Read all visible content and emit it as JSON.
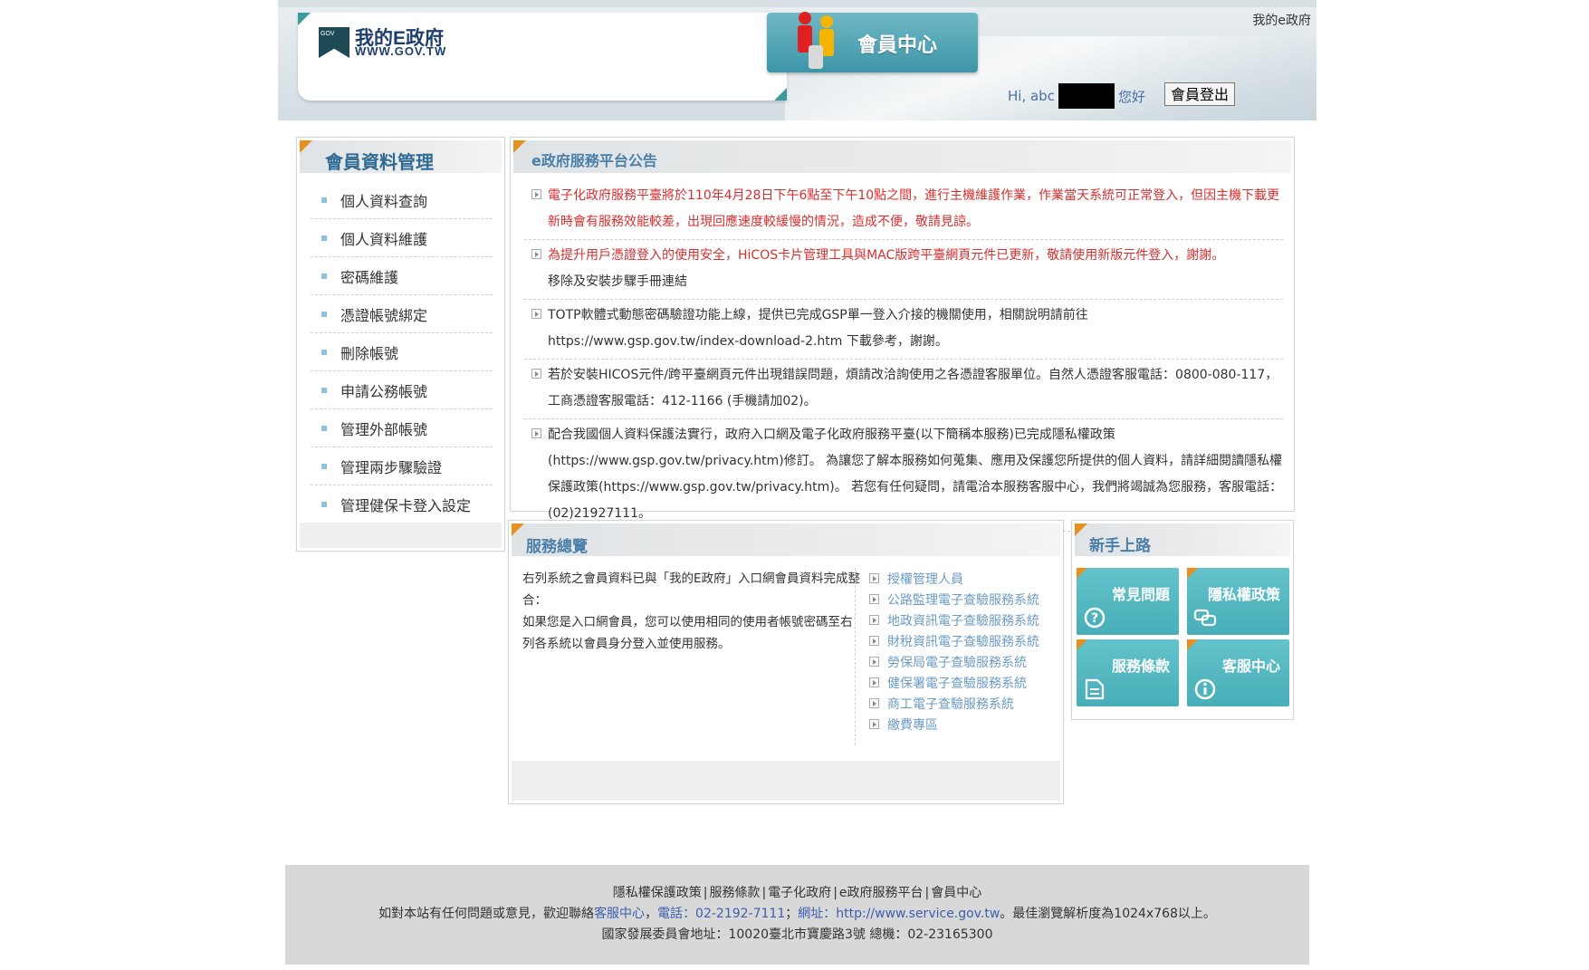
{
  "header": {
    "logo_main": "我的E政府",
    "logo_url": "WWW.GOV.TW",
    "logo_badge": "GOV",
    "banner_title": "會員中心",
    "top_link": "我的e政府",
    "greeting_prefix": "Hi, abc",
    "greeting_suffix": "您好",
    "logout_label": "會員登出"
  },
  "sidebar": {
    "title": "會員資料管理",
    "items": [
      {
        "label": "個人資料查詢"
      },
      {
        "label": "個人資料維護"
      },
      {
        "label": "密碼維護"
      },
      {
        "label": "憑證帳號綁定"
      },
      {
        "label": "刪除帳號"
      },
      {
        "label": "申請公務帳號"
      },
      {
        "label": "管理外部帳號"
      },
      {
        "label": "管理兩步驟驗證"
      },
      {
        "label": "管理健保卡登入設定"
      }
    ]
  },
  "announcements": {
    "title": "e政府服務平台公告",
    "items": [
      {
        "text": "電子化政府服務平臺將於110年4月28日下午6點至下午10點之間，進行主機維護作業，作業當天系統可正常登入，但因主機下載更新時會有服務效能較差，出現回應速度較緩慢的情況，造成不便，敬請見諒。",
        "highlight": true
      },
      {
        "text": "為提升用戶憑證登入的使用安全，HiCOS卡片管理工具與MAC版跨平臺網頁元件已更新，敬請使用新版元件登入，謝謝。",
        "extra": "移除及安裝步驟手冊連結",
        "highlight": true
      },
      {
        "text": "TOTP軟體式動態密碼驗證功能上線，提供已完成GSP單一登入介接的機關使用，相關說明請前往 https://www.gsp.gov.tw/index-download-2.htm 下載參考，謝謝。",
        "highlight": false
      },
      {
        "text": "若於安裝HICOS元件/跨平臺網頁元件出現錯誤問題，煩請改洽詢使用之各憑證客服單位。自然人憑證客服電話：0800-080-117，工商憑證客服電話：412-1166 (手機請加02)。",
        "highlight": false
      },
      {
        "text": "配合我國個人資料保護法實行，政府入口網及電子化政府服務平臺(以下簡稱本服務)已完成隱私權政策(https://www.gsp.gov.tw/privacy.htm)修訂。 為讓您了解本服務如何蒐集、應用及保護您所提供的個人資料，請詳細閱讀隱私權保護政策(https://www.gsp.gov.tw/privacy.htm)。 若您有任何疑問，請電洽本服務客服中心，我們將竭誠為您服務，客服電話：(02)21927111。",
        "highlight": false
      }
    ]
  },
  "services": {
    "title": "服務總覽",
    "desc_1": "右列系統之會員資料已與「我的E政府」入口網會員資料完成整合：",
    "desc_2": "如果您是入口網會員，您可以使用相同的使用者帳號密碼至右列各系統以會員身分登入並使用服務。",
    "items": [
      {
        "label": "授權管理人員"
      },
      {
        "label": "公路監理電子查驗服務系統"
      },
      {
        "label": "地政資訊電子查驗服務系統"
      },
      {
        "label": "財稅資訊電子查驗服務系統"
      },
      {
        "label": "勞保局電子查驗服務系統"
      },
      {
        "label": "健保署電子查驗服務系統"
      },
      {
        "label": "商工電子查驗服務系統"
      },
      {
        "label": "繳費專區"
      }
    ]
  },
  "newbie": {
    "title": "新手上路",
    "tiles": [
      {
        "label": "常見問題",
        "icon": "question-icon"
      },
      {
        "label": "隱私權政策",
        "icon": "chat-icon"
      },
      {
        "label": "服務條款",
        "icon": "document-icon"
      },
      {
        "label": "客服中心",
        "icon": "info-icon"
      }
    ]
  },
  "footer": {
    "links": [
      "隱私權保護政策",
      "服務條款",
      "電子化政府",
      "e政府服務平台",
      "會員中心"
    ],
    "contact_prefix": "如對本站有任何問題或意見，歡迎聯絡",
    "contact_center": "客服中心",
    "comma_1": "，",
    "phone_label": "電話",
    "phone_value": "：02-2192-7111",
    "url_label": "網址",
    "url_value": "：http://www.service.gov.tw",
    "contact_suffix": "。最佳瀏覽解析度為1024x768以上。",
    "address": "國家發展委員會地址：10020臺北市寶慶路3號 總機：02-23165300"
  },
  "colors": {
    "accent_teal": "#48aeb8",
    "flag_orange": "#e8901f",
    "title_blue": "#4a7fa9",
    "alert_red": "#d52f2f",
    "link_blue": "#3d5fb0"
  }
}
